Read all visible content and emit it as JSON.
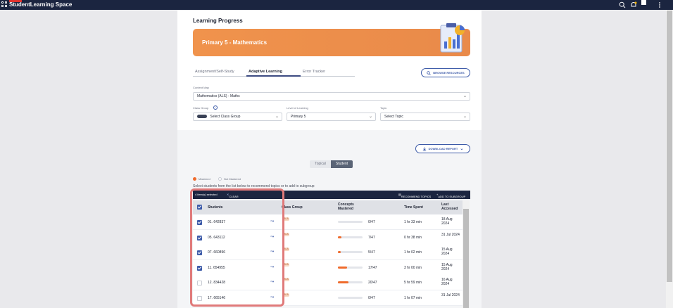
{
  "app": {
    "brand_part1": "Student",
    "brand_part2": "Learning Space",
    "badge_color": "#e2342f"
  },
  "page": {
    "title": "Learning Progress",
    "banner_title": "Primary 5 - Mathematics",
    "tabs": [
      "Assignment/Self-Study",
      "Adaptive Learning",
      "Error Tracker"
    ],
    "active_tab": "Adaptive Learning",
    "browse_resources": "BROWSE RESOURCES"
  },
  "filters": {
    "content_map_label": "Content Map",
    "content_map_value": "Mathematics (ALS) - Maths",
    "class_group_label": "Class Group",
    "class_group_placeholder": "Select Class Group",
    "level_label": "Level of Learning",
    "level_value": "Primary 5",
    "topic_label": "Topic",
    "topic_placeholder": "Select Topic"
  },
  "report": {
    "download": "DOWNLOAD REPORT",
    "views": [
      "Topical",
      "Student"
    ],
    "active_view": "Student",
    "legend": [
      "Mastered",
      "Not Mastered"
    ],
    "hint": "Select students from the list below to recommend topics or to add to subgroup"
  },
  "selection_bar": {
    "selected": "4 item(s) selected",
    "clear": "CLEAR",
    "recommend": "RECOMMEND TOPICS",
    "add_subgroup": "ADD TO SUBGROUP"
  },
  "table": {
    "headers": [
      "Students",
      "Class Group",
      "Concepts Mastered",
      "Time Spent",
      "Last Accessed"
    ],
    "rows": [
      {
        "student": "01. 642837",
        "group": "N.A",
        "mastered": "0/47",
        "progress": 0,
        "time": "1 hr 33 min",
        "last": "18 Aug 2024",
        "checked": true
      },
      {
        "student": "05. 643112",
        "group": "N.A",
        "mastered": "7/47",
        "progress": 0.149,
        "time": "0 hr 38 min",
        "last": "31 Jul 2024",
        "checked": true
      },
      {
        "student": "07. 660896",
        "group": "N.A",
        "mastered": "5/47",
        "progress": 0.106,
        "time": "1 hr 02 min",
        "last": "15 Aug 2024",
        "checked": true
      },
      {
        "student": "11. 654955",
        "group": "N.A",
        "mastered": "17/47",
        "progress": 0.362,
        "time": "3 hr 00 min",
        "last": "15 Aug 2024",
        "checked": true
      },
      {
        "student": "12. 834428",
        "group": "N.A",
        "mastered": "20/47",
        "progress": 0.426,
        "time": "5 hr 59 min",
        "last": "16 Aug 2024",
        "checked": false
      },
      {
        "student": "17. 665146",
        "group": "N.A",
        "mastered": "0/47",
        "progress": 0,
        "time": "1 hr 07 min",
        "last": "31 Jul 2024",
        "checked": false
      }
    ]
  },
  "icons": [
    "grid-icon",
    "search-icon",
    "bell-icon",
    "more-icon",
    "chevron-down-icon",
    "info-icon",
    "download-icon",
    "close-icon",
    "trend-icon"
  ],
  "colors": {
    "accent": "#3c5aa8",
    "navbar": "#1b2540",
    "banner": "#f0934c",
    "progress": "#ef6b2c",
    "highlight": "#e07a7a"
  }
}
